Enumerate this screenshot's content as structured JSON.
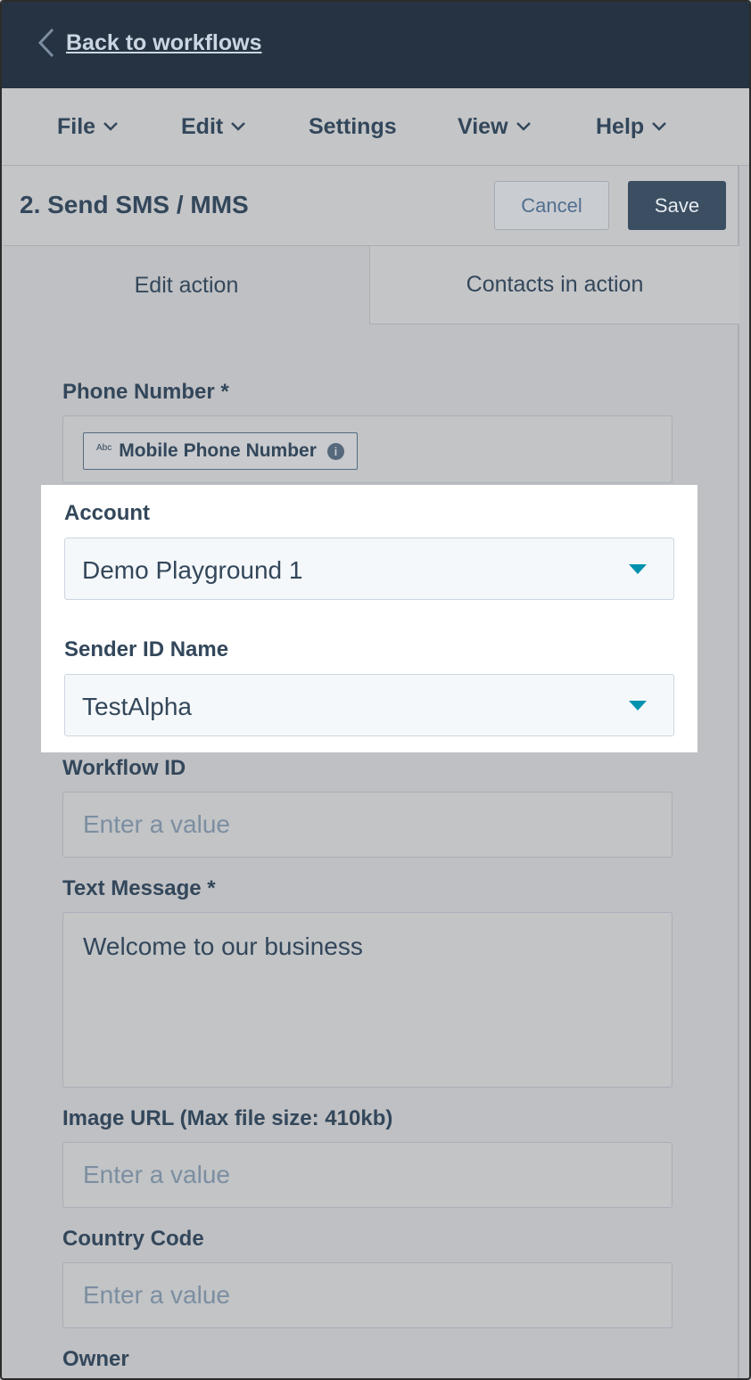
{
  "topbar": {
    "back_label": "Back to workflows"
  },
  "menu": {
    "items": [
      "File",
      "Edit",
      "Settings",
      "View",
      "Help"
    ]
  },
  "panel": {
    "title": "2. Send SMS / MMS",
    "cancel_label": "Cancel",
    "save_label": "Save",
    "tabs": [
      "Edit action",
      "Contacts in action"
    ]
  },
  "form": {
    "phone_label": "Phone Number *",
    "phone_token_prefix": "Abc",
    "phone_token": "Mobile Phone Number",
    "account_label": "Account",
    "account_value": "Demo Playground 1",
    "sender_label": "Sender ID Name",
    "sender_value": "TestAlpha",
    "workflow_label": "Workflow ID",
    "workflow_placeholder": "Enter a value",
    "message_label": "Text Message *",
    "message_value": "Welcome to our business",
    "image_label": "Image URL (Max file size: 410kb)",
    "image_placeholder": "Enter a value",
    "country_label": "Country Code",
    "country_placeholder": "Enter a value",
    "owner_label": "Owner"
  },
  "colors": {
    "topbar": "#253342",
    "dropdown_caret": "#0091ae",
    "save_button": "#3b4e62"
  }
}
